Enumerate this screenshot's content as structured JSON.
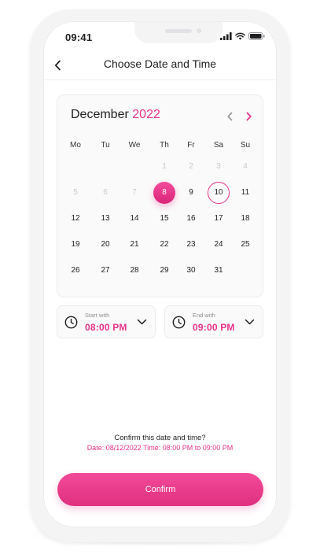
{
  "status_bar": {
    "time": "09:41"
  },
  "header": {
    "title": "Choose Date and Time"
  },
  "calendar": {
    "month": "December",
    "year": "2022",
    "weekdays": [
      "Mo",
      "Tu",
      "We",
      "Th",
      "Fr",
      "Sa",
      "Su"
    ],
    "weeks": [
      [
        null,
        null,
        null,
        "1",
        "2",
        "3",
        "4"
      ],
      [
        "5",
        "6",
        "7",
        "8",
        "9",
        "10",
        "11"
      ],
      [
        "12",
        "13",
        "14",
        "15",
        "16",
        "17",
        "18"
      ],
      [
        "19",
        "20",
        "21",
        "22",
        "23",
        "24",
        "25"
      ],
      [
        "26",
        "27",
        "28",
        "29",
        "30",
        "31",
        null
      ]
    ],
    "disabled_through": "7",
    "selected_day": "8",
    "today_day": "10"
  },
  "time": {
    "start": {
      "caption": "Start with",
      "value": "08:00 PM"
    },
    "end": {
      "caption": "End with",
      "value": "09:00 PM"
    }
  },
  "confirm": {
    "question": "Confirm this date and time?",
    "details": "Date: 08/12/2022  Time: 08:00 PM to 09:00 PM",
    "button_label": "Confirm"
  },
  "colors": {
    "accent": "#e8338a",
    "muted_text": "#c9c9cd",
    "card_bg": "#fafafa"
  },
  "icons": [
    "back-arrow-icon",
    "chevron-left-icon",
    "chevron-right-icon",
    "clock-icon",
    "chevron-down-icon",
    "signal-icon",
    "wifi-icon",
    "battery-icon"
  ]
}
